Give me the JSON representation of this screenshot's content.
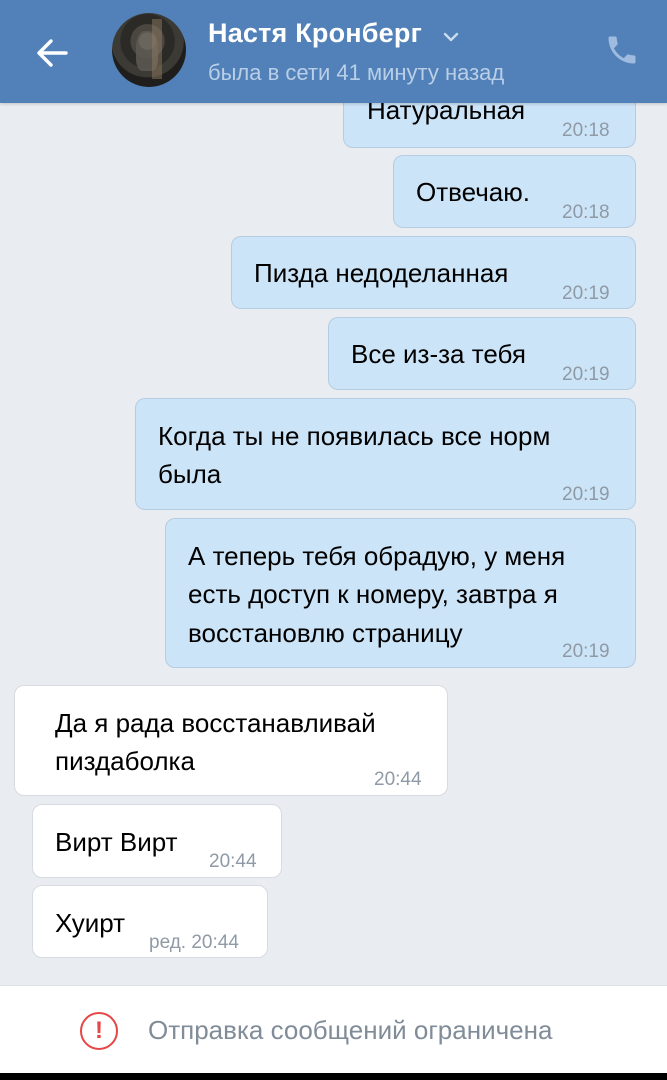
{
  "header": {
    "contact_name": "Настя Кронберг",
    "status": "была в сети 41 минуту назад",
    "icons": {
      "back": "arrow-left-icon",
      "dropdown": "chevron-down-icon",
      "call": "phone-icon"
    }
  },
  "messages": [
    {
      "direction": "outgoing",
      "text": "Натуральная",
      "time": "20:18"
    },
    {
      "direction": "outgoing",
      "text": "Отвечаю.",
      "time": "20:18"
    },
    {
      "direction": "outgoing",
      "text": "Пизда недоделанная",
      "time": "20:19"
    },
    {
      "direction": "outgoing",
      "text": "Все из-за тебя",
      "time": "20:19"
    },
    {
      "direction": "outgoing",
      "lines": [
        "Когда ты не появилась все норм",
        "была"
      ],
      "time": "20:19"
    },
    {
      "direction": "outgoing",
      "lines": [
        "А теперь тебя обрадую, у меня",
        "есть доступ к номеру, завтра я",
        "восстановлю страницу"
      ],
      "time": "20:19"
    },
    {
      "direction": "incoming",
      "lines": [
        "Да я рада восстанавливай",
        "пиздаболка"
      ],
      "time": "20:44"
    },
    {
      "direction": "incoming",
      "text": "Вирт Вирт",
      "time": "20:44"
    },
    {
      "direction": "incoming",
      "text": "Хуирт",
      "time": "ред. 20:44"
    }
  ],
  "footer": {
    "notice": "Отправка сообщений ограничена",
    "icon": "warning-circle-icon"
  },
  "colors": {
    "header_bg": "#5181b8",
    "outgoing_bubble": "#cce4f7",
    "incoming_bubble": "#ffffff",
    "chat_bg": "#e9ecf0",
    "warning": "#e64646"
  }
}
